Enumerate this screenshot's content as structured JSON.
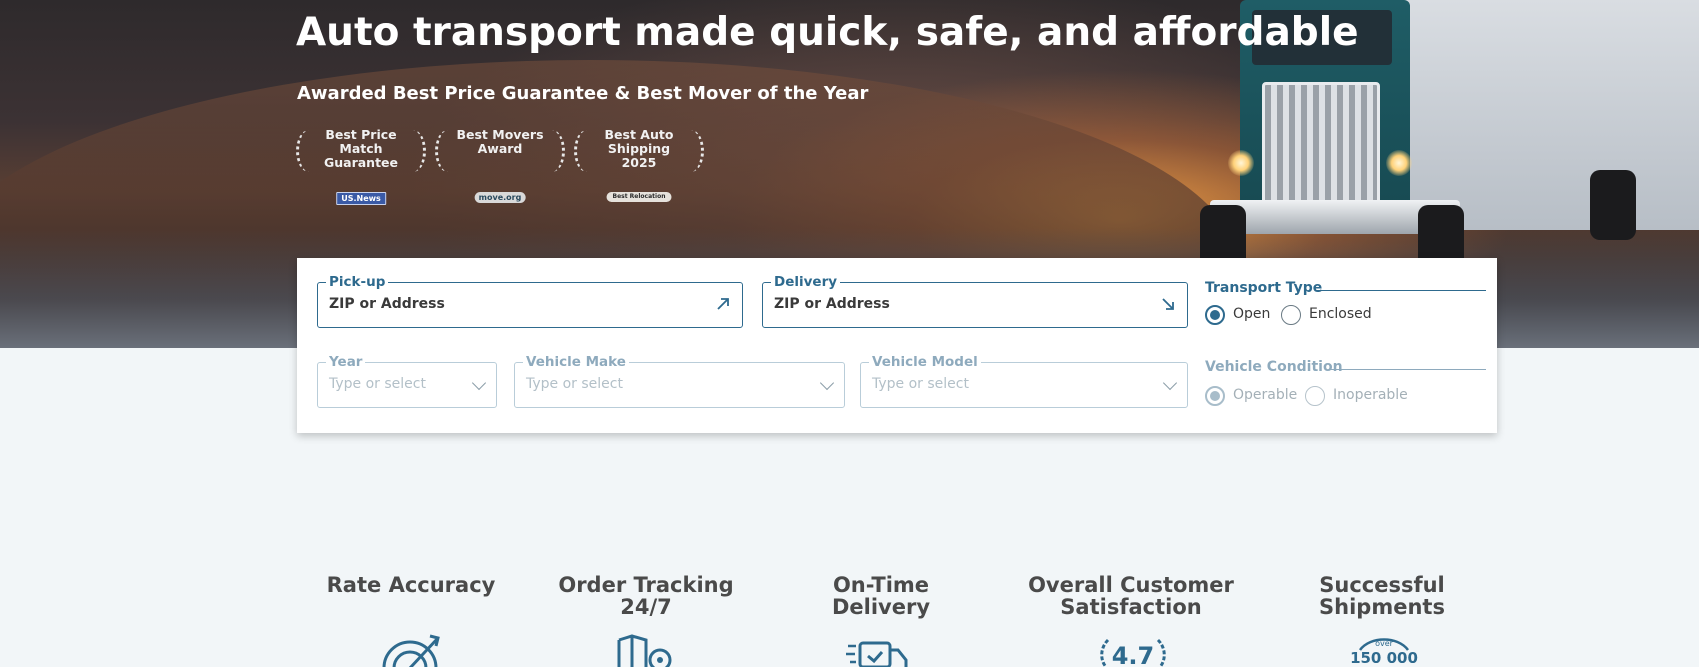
{
  "hero": {
    "title": "Auto transport made quick, safe, and affordable",
    "subtitle": "Awarded Best Price Guarantee & Best Mover of the Year",
    "awards": [
      {
        "text": "Best Price Match Guarantee",
        "logo": "US.News"
      },
      {
        "text": "Best Movers Award",
        "logo": "move.org"
      },
      {
        "text": "Best Auto Shipping 2025",
        "logo": "Best Relocation"
      }
    ]
  },
  "form": {
    "pickup": {
      "label": "Pick-up",
      "placeholder": "ZIP or Address"
    },
    "delivery": {
      "label": "Delivery",
      "placeholder": "ZIP or Address"
    },
    "transport_type": {
      "label": "Transport Type",
      "options": [
        "Open",
        "Enclosed"
      ],
      "selected": "Open"
    },
    "year": {
      "label": "Year",
      "placeholder": "Type or select"
    },
    "make": {
      "label": "Vehicle Make",
      "placeholder": "Type or select"
    },
    "model": {
      "label": "Vehicle Model",
      "placeholder": "Type or select"
    },
    "vehicle_condition": {
      "label": "Vehicle Condition",
      "options": [
        "Operable",
        "Inoperable"
      ],
      "selected": "Operable"
    }
  },
  "stats": [
    {
      "title": "Rate Accuracy",
      "icon": "target-icon"
    },
    {
      "title": "Order Tracking 24/7",
      "icon": "map-pin-icon"
    },
    {
      "title": "On-Time Delivery",
      "icon": "delivery-truck-icon"
    },
    {
      "title": "Overall Customer Satisfaction",
      "icon": "rating-wreath-icon",
      "value": "4.7"
    },
    {
      "title": "Successful Shipments",
      "icon": "gauge-icon",
      "prefix": "over",
      "value": "150 000"
    }
  ],
  "colors": {
    "accent": "#2e6a8e",
    "background": "#f2f6f8",
    "text": "#4a4a4a"
  }
}
